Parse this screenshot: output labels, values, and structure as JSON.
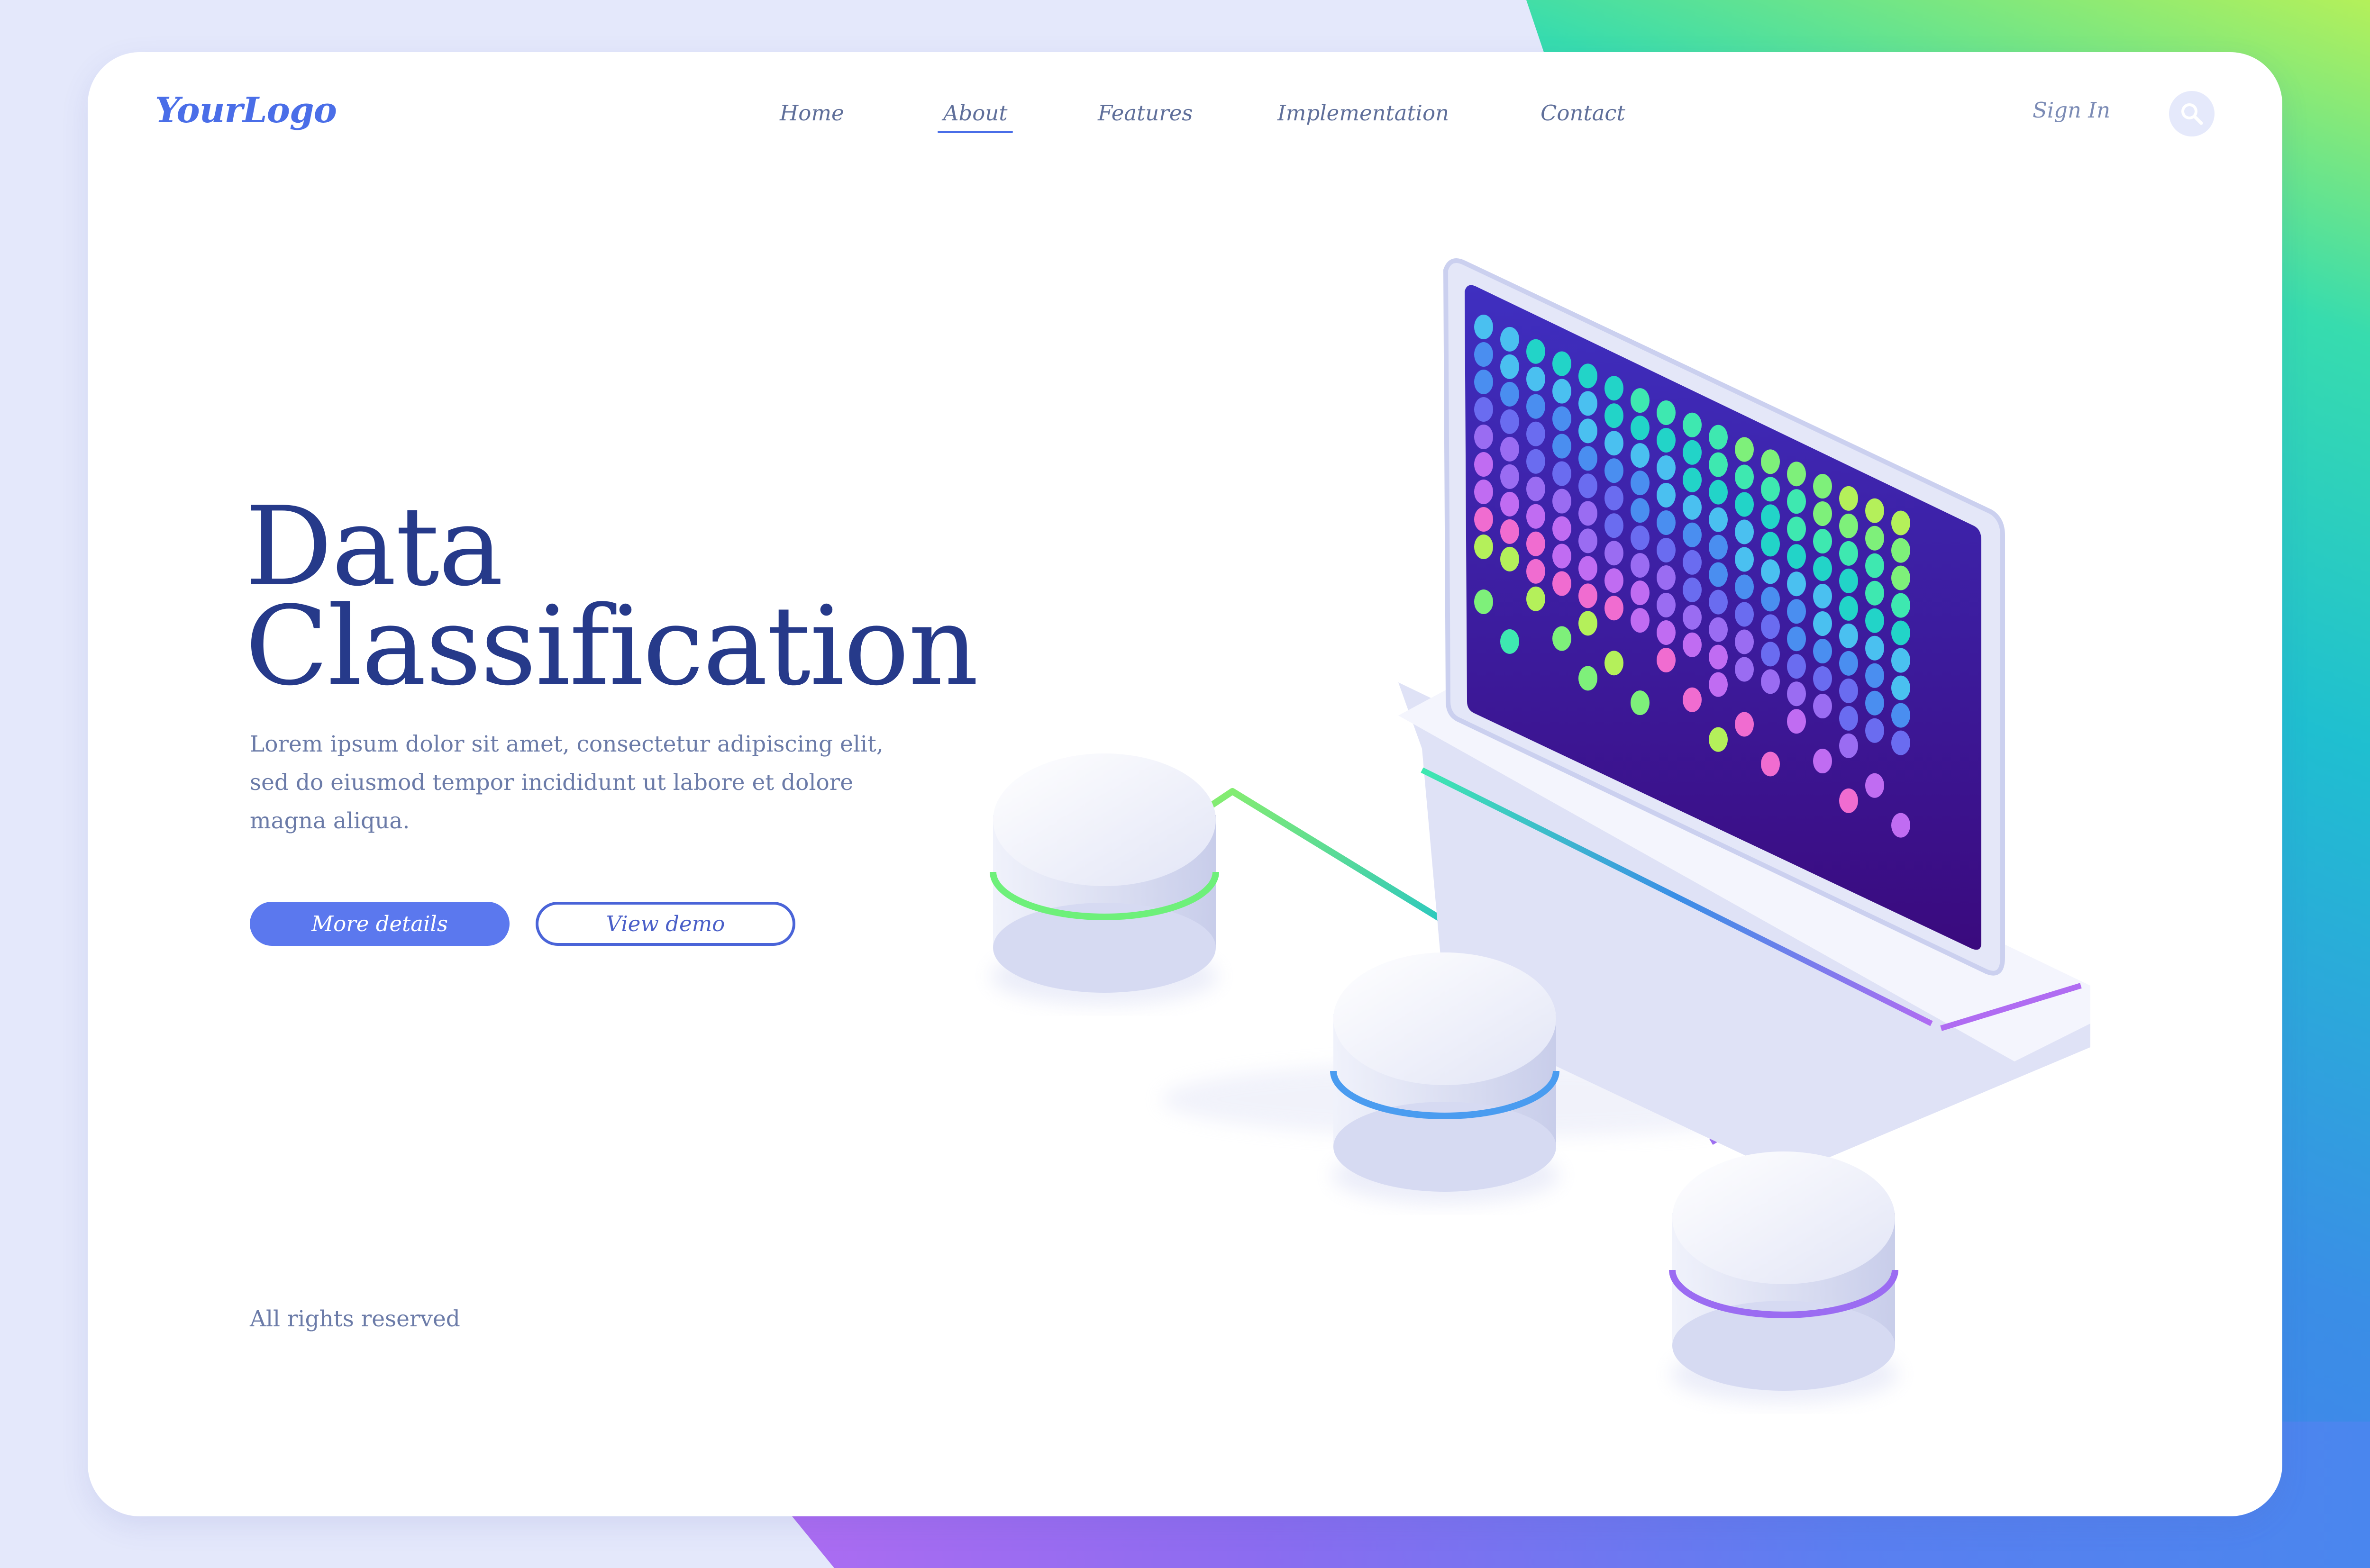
{
  "header": {
    "logo": "YourLogo",
    "nav": [
      {
        "label": "Home",
        "active": false
      },
      {
        "label": "About",
        "active": true
      },
      {
        "label": "Features",
        "active": false
      },
      {
        "label": "Implementation",
        "active": false
      },
      {
        "label": "Contact",
        "active": false
      }
    ],
    "sign_in": "Sign In",
    "search_icon": "search-icon"
  },
  "hero": {
    "title_line1": "Data",
    "title_line2": "Classification",
    "description": "Lorem ipsum dolor sit amet, consectetur adipiscing elit, sed do eiusmod tempor incididunt ut labore et dolore magna aliqua.",
    "primary_button": "More details",
    "secondary_button": "View demo"
  },
  "footer": {
    "copyright": "All rights reserved"
  },
  "colors": {
    "accent": "#5b78ee",
    "title": "#263a8a",
    "body_text": "#6b7ba8",
    "screen": "#3a1fa8",
    "green_line": "#6ef07a",
    "blue_line": "#3a8ee6",
    "purple_line": "#b06cf2"
  }
}
